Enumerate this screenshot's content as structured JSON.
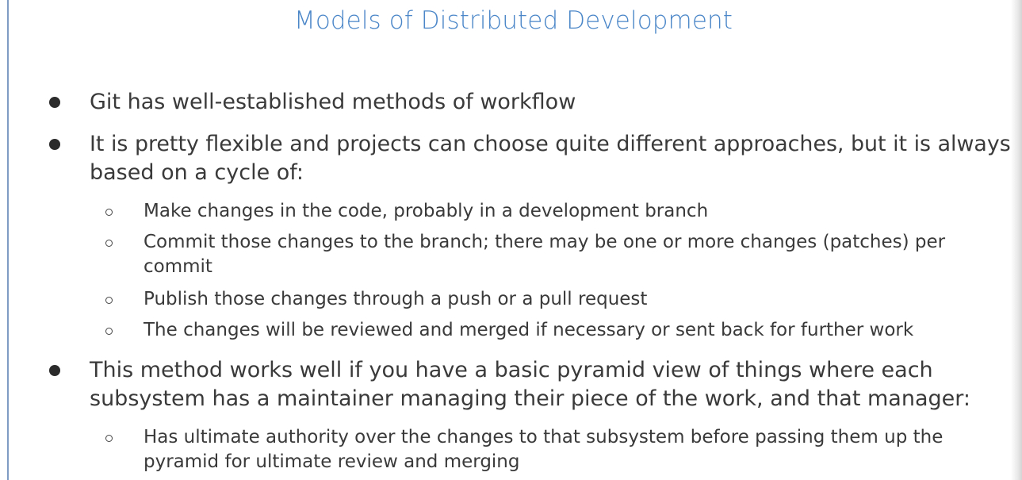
{
  "slide": {
    "title": "Models of Distributed Development",
    "bullets": [
      {
        "level": 1,
        "lines": [
          "Git has well-established methods of workflow"
        ]
      },
      {
        "level": 1,
        "lines": [
          "It is pretty flexible and projects can choose quite different approaches, but it is always",
          "based on a cycle of:"
        ]
      },
      {
        "level": 2,
        "lines": [
          "Make changes in the code, probably in a development branch"
        ]
      },
      {
        "level": 2,
        "lines": [
          "Commit those changes to the branch; there may be one or more changes (patches) per",
          "commit"
        ]
      },
      {
        "level": 2,
        "lines": [
          "Publish those changes through a push or a pull request"
        ]
      },
      {
        "level": 2,
        "lines": [
          "The changes will be reviewed and merged if necessary or sent back for further work"
        ]
      },
      {
        "level": 1,
        "lines": [
          "This method works well if you have a basic pyramid view of things where each",
          "subsystem has a maintainer managing their piece of the work, and that manager:"
        ]
      },
      {
        "level": 2,
        "lines": [
          "Has ultimate authority over the changes to that subsystem before passing them up the",
          "pyramid for ultimate review and merging"
        ]
      }
    ]
  }
}
